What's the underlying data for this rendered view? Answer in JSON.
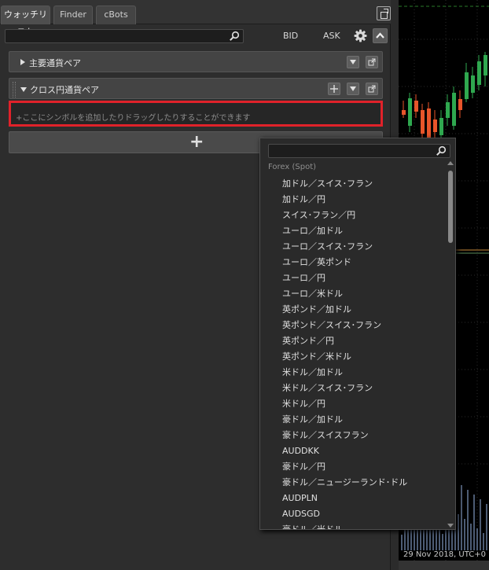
{
  "tabs": [
    {
      "label": "ウォッチリスト",
      "active": true
    },
    {
      "label": "Finder",
      "active": false
    },
    {
      "label": "cBots",
      "active": false
    }
  ],
  "toolbar": {
    "search_placeholder": "",
    "bid_label": "BID",
    "ask_label": "ASK"
  },
  "groups": [
    {
      "title": "主要通貨ペア",
      "expanded": false
    },
    {
      "title": "クロス円通貨ペア",
      "expanded": true
    }
  ],
  "drop_zone": {
    "hint": "+ここにシンボルを追加したりドラッグしたりすることができます"
  },
  "add_row": {
    "label": "+"
  },
  "dropdown": {
    "search_placeholder": "",
    "group_label": "Forex (Spot)",
    "items": [
      "加ドル／スイス･フラン",
      "加ドル／円",
      "スイス･フラン／円",
      "ユーロ／加ドル",
      "ユーロ／スイス･フラン",
      "ユーロ／英ポンド",
      "ユーロ／円",
      "ユーロ／米ドル",
      "英ポンド／加ドル",
      "英ポンド／スイス･フラン",
      "英ポンド／円",
      "英ポンド／米ドル",
      "米ドル／加ドル",
      "米ドル／スイス･フラン",
      "米ドル／円",
      "豪ドル／加ドル",
      "豪ドル／スイスフラン",
      "AUDDKK",
      "豪ドル／円",
      "豪ドル／ニュージーランド･ドル",
      "AUDPLN",
      "AUDSGD",
      "豪ドル／米ドル"
    ]
  },
  "chart": {
    "date_label": "29 Nov 2018, UTC+0"
  },
  "colors": {
    "highlight_border": "#e0222a",
    "candle_up": "#2fa84f",
    "candle_down": "#e8552a"
  },
  "icons": [
    "search-icon",
    "gear-icon",
    "chevron-up-icon",
    "chevron-down-icon",
    "pop-out-icon",
    "plus-icon",
    "detach-icon",
    "triangle-right-icon",
    "triangle-down-icon"
  ]
}
